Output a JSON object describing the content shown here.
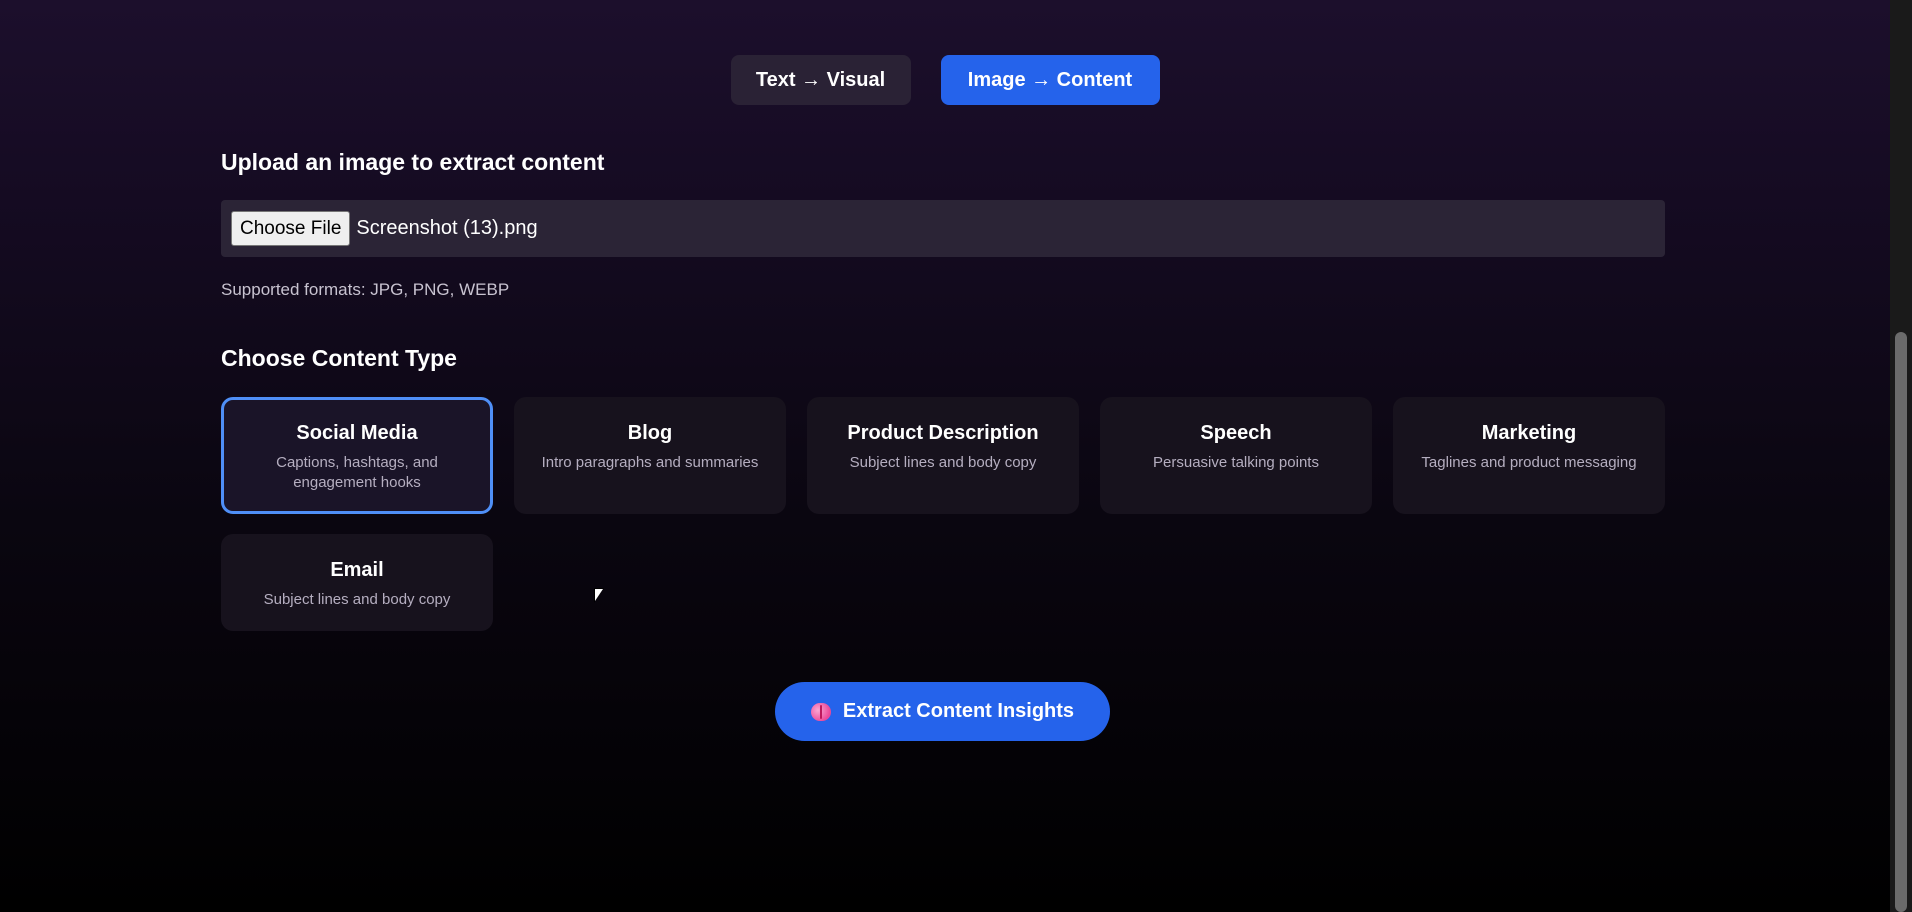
{
  "tabs": {
    "text_visual": "Text → Visual",
    "image_content": "Image → Content"
  },
  "upload": {
    "heading": "Upload an image to extract content",
    "choose_label": "Choose File",
    "file_name": "Screenshot (13).png",
    "formats": "Supported formats: JPG, PNG, WEBP"
  },
  "content_type": {
    "heading": "Choose Content Type",
    "cards": [
      {
        "title": "Social Media",
        "desc": "Captions, hashtags, and engagement hooks"
      },
      {
        "title": "Blog",
        "desc": "Intro paragraphs and summaries"
      },
      {
        "title": "Product Description",
        "desc": "Subject lines and body copy"
      },
      {
        "title": "Speech",
        "desc": "Persuasive talking points"
      },
      {
        "title": "Marketing",
        "desc": "Taglines and product messaging"
      },
      {
        "title": "Email",
        "desc": "Subject lines and body copy"
      }
    ]
  },
  "action": {
    "extract_label": "Extract Content Insights",
    "icon": "brain-icon"
  },
  "colors": {
    "accent": "#2563eb",
    "selected_border": "#4f8ff7"
  }
}
